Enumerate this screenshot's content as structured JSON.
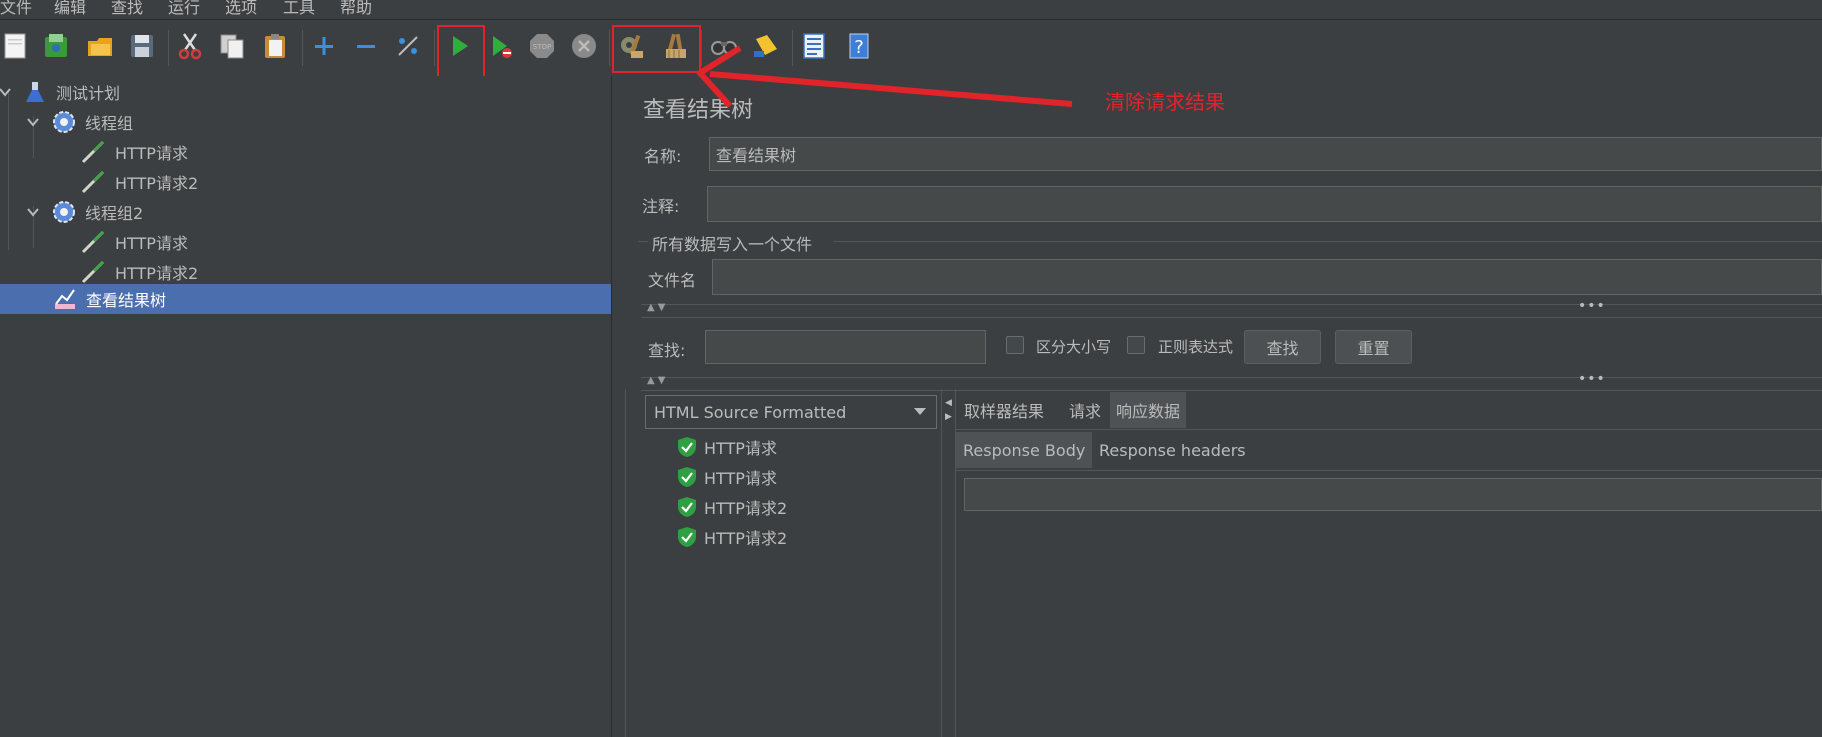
{
  "menubar": {
    "items": [
      "文件",
      "编辑",
      "查找",
      "运行",
      "选项",
      "工具",
      "帮助"
    ]
  },
  "toolbar": {
    "icons": [
      "new-plan-icon",
      "templates-icon",
      "open-icon",
      "save-icon",
      "cut-icon",
      "copy-icon",
      "paste-icon",
      "expand-icon",
      "collapse-icon",
      "toggle-icon",
      "start-icon",
      "start-no-pause-icon",
      "stop-icon",
      "shutdown-icon",
      "clear-icon",
      "clear-all-icon",
      "search-icon",
      "reset-search-icon",
      "function-helper-icon",
      "help-icon"
    ]
  },
  "annotation": {
    "text": "清除请求结果",
    "color": "#e0242a"
  },
  "tree": {
    "items": [
      {
        "label": "测试计划",
        "icon": "test-plan-icon",
        "level": 0,
        "expanded": true
      },
      {
        "label": "线程组",
        "icon": "thread-group-icon",
        "level": 1,
        "expanded": true
      },
      {
        "label": "HTTP请求",
        "icon": "sampler-icon",
        "level": 2
      },
      {
        "label": "HTTP请求2",
        "icon": "sampler-icon",
        "level": 2
      },
      {
        "label": "线程组2",
        "icon": "thread-group-icon",
        "level": 1,
        "expanded": true
      },
      {
        "label": "HTTP请求",
        "icon": "sampler-icon",
        "level": 2
      },
      {
        "label": "HTTP请求2",
        "icon": "sampler-icon",
        "level": 2
      },
      {
        "label": "查看结果树",
        "icon": "listener-icon",
        "level": 1,
        "selected": true
      }
    ],
    "selected_color": "#4b6eaf"
  },
  "panel": {
    "title": "查看结果树",
    "name_label": "名称:",
    "name_value": "查看结果树",
    "comment_label": "注释:",
    "comment_value": "",
    "file_group_title": "所有数据写入一个文件",
    "filename_label": "文件名",
    "filename_value": ""
  },
  "search": {
    "label": "查找:",
    "value": "",
    "case_sensitive_label": "区分大小写",
    "regex_label": "正则表达式",
    "search_button": "查找",
    "reset_button": "重置"
  },
  "results": {
    "renderer": "HTML Source Formatted",
    "items": [
      "HTTP请求",
      "HTTP请求",
      "HTTP请求2",
      "HTTP请求2"
    ],
    "status_color": "#2ea043"
  },
  "result_tabs": {
    "tabs": [
      "取样器结果",
      "请求",
      "响应数据"
    ],
    "active": "响应数据",
    "subtabs": [
      "Response Body",
      "Response headers"
    ],
    "active_subtab": "Response Body"
  }
}
